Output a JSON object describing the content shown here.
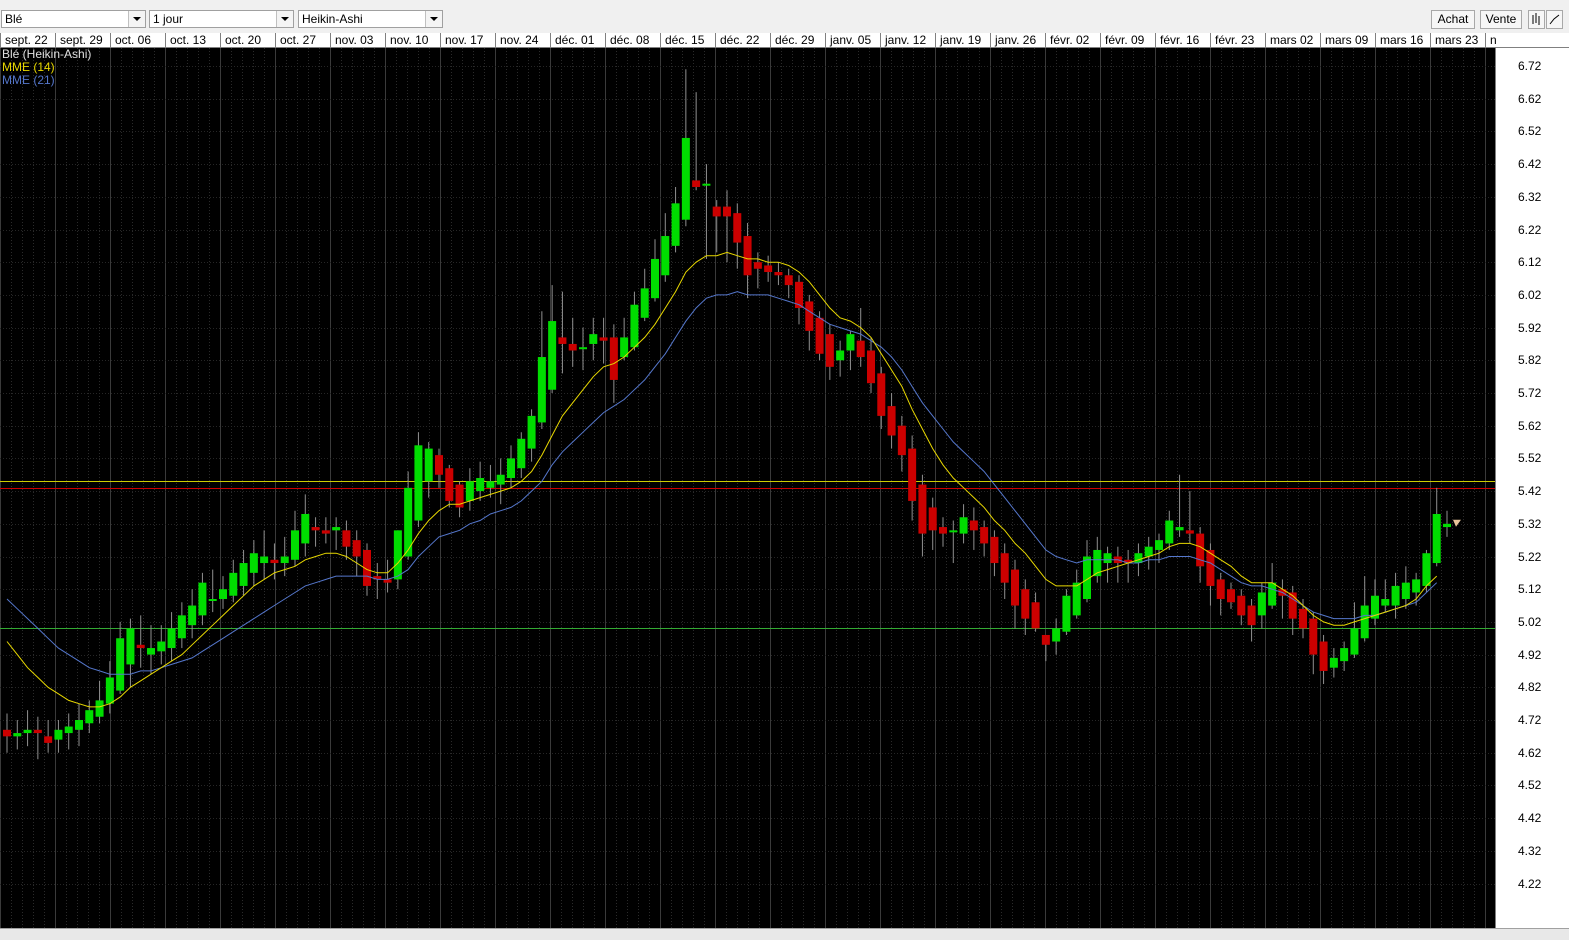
{
  "toolbar": {
    "instrument": "Blé",
    "period": "1 jour",
    "chart_style": "Heikin-Ashi",
    "buy_label": "Achat",
    "sell_label": "Vente",
    "bars_icon": "bar-chart-icon",
    "line_icon": "line-chart-icon"
  },
  "dates": [
    "sept. 22",
    "sept. 29",
    "oct. 06",
    "oct. 13",
    "oct. 20",
    "oct. 27",
    "nov. 03",
    "nov. 10",
    "nov. 17",
    "nov. 24",
    "déc. 01",
    "déc. 08",
    "déc. 15",
    "déc. 22",
    "déc. 29",
    "janv. 05",
    "janv. 12",
    "janv. 19",
    "janv. 26",
    "févr. 02",
    "févr. 09",
    "févr. 16",
    "févr. 23",
    "mars 02",
    "mars 09",
    "mars 16",
    "mars 23",
    "n"
  ],
  "price_labels": [
    "6.72",
    "6.62",
    "6.52",
    "6.42",
    "6.32",
    "6.22",
    "6.12",
    "6.02",
    "5.92",
    "5.82",
    "5.72",
    "5.62",
    "5.52",
    "5.42",
    "5.32",
    "5.22",
    "5.12",
    "5.02",
    "4.92",
    "4.82",
    "4.72",
    "4.62",
    "4.52",
    "4.42",
    "4.32",
    "4.22"
  ],
  "legend": {
    "title": "Blé (Heikin-Ashi)",
    "ema14": "MME (14)",
    "ema21": "MME (21)"
  },
  "colors": {
    "up": "#00dd00",
    "down": "#cc0000",
    "ema14": "#e8d800",
    "ema21": "#5577cc",
    "hline_yellow": "#cccc00",
    "hline_red": "#cc0000",
    "hline_green": "#33aa33",
    "last_marker": "#e8c49a"
  },
  "chart_data": {
    "type": "candlestick",
    "title": "Blé (Heikin-Ashi)",
    "xlabel": "",
    "ylabel": "",
    "ylim": [
      4.17,
      6.78
    ],
    "grid": true,
    "legend_position": "top-left",
    "horizontal_lines": [
      5.45,
      5.43,
      5.0
    ],
    "candles": [
      {
        "o": 4.69,
        "h": 4.74,
        "l": 4.62,
        "c": 4.67
      },
      {
        "o": 4.67,
        "h": 4.72,
        "l": 4.63,
        "c": 4.68
      },
      {
        "o": 4.68,
        "h": 4.75,
        "l": 4.64,
        "c": 4.69
      },
      {
        "o": 4.69,
        "h": 4.73,
        "l": 4.6,
        "c": 4.68
      },
      {
        "o": 4.67,
        "h": 4.72,
        "l": 4.62,
        "c": 4.65
      },
      {
        "o": 4.66,
        "h": 4.72,
        "l": 4.62,
        "c": 4.69
      },
      {
        "o": 4.68,
        "h": 4.74,
        "l": 4.63,
        "c": 4.7
      },
      {
        "o": 4.69,
        "h": 4.77,
        "l": 4.64,
        "c": 4.72
      },
      {
        "o": 4.71,
        "h": 4.78,
        "l": 4.68,
        "c": 4.75
      },
      {
        "o": 4.73,
        "h": 4.84,
        "l": 4.71,
        "c": 4.78
      },
      {
        "o": 4.77,
        "h": 4.9,
        "l": 4.74,
        "c": 4.85
      },
      {
        "o": 4.81,
        "h": 5.02,
        "l": 4.8,
        "c": 4.97
      },
      {
        "o": 4.89,
        "h": 5.03,
        "l": 4.82,
        "c": 5.0
      },
      {
        "o": 4.95,
        "h": 5.04,
        "l": 4.88,
        "c": 4.94
      },
      {
        "o": 4.92,
        "h": 5.01,
        "l": 4.86,
        "c": 4.94
      },
      {
        "o": 4.93,
        "h": 5.01,
        "l": 4.89,
        "c": 4.96
      },
      {
        "o": 4.94,
        "h": 5.05,
        "l": 4.9,
        "c": 5.0
      },
      {
        "o": 4.97,
        "h": 5.08,
        "l": 4.94,
        "c": 5.04
      },
      {
        "o": 5.01,
        "h": 5.12,
        "l": 4.97,
        "c": 5.07
      },
      {
        "o": 5.04,
        "h": 5.17,
        "l": 5.01,
        "c": 5.14
      },
      {
        "o": 5.09,
        "h": 5.18,
        "l": 5.05,
        "c": 5.09
      },
      {
        "o": 5.09,
        "h": 5.16,
        "l": 5.06,
        "c": 5.12
      },
      {
        "o": 5.1,
        "h": 5.21,
        "l": 5.08,
        "c": 5.17
      },
      {
        "o": 5.13,
        "h": 5.24,
        "l": 5.1,
        "c": 5.2
      },
      {
        "o": 5.17,
        "h": 5.27,
        "l": 5.13,
        "c": 5.23
      },
      {
        "o": 5.2,
        "h": 5.3,
        "l": 5.15,
        "c": 5.22
      },
      {
        "o": 5.21,
        "h": 5.26,
        "l": 5.15,
        "c": 5.2
      },
      {
        "o": 5.2,
        "h": 5.28,
        "l": 5.16,
        "c": 5.22
      },
      {
        "o": 5.21,
        "h": 5.36,
        "l": 5.19,
        "c": 5.3
      },
      {
        "o": 5.26,
        "h": 5.41,
        "l": 5.22,
        "c": 5.35
      },
      {
        "o": 5.31,
        "h": 5.34,
        "l": 5.25,
        "c": 5.3
      },
      {
        "o": 5.3,
        "h": 5.34,
        "l": 5.26,
        "c": 5.29
      },
      {
        "o": 5.3,
        "h": 5.34,
        "l": 5.24,
        "c": 5.31
      },
      {
        "o": 5.3,
        "h": 5.33,
        "l": 5.21,
        "c": 5.25
      },
      {
        "o": 5.27,
        "h": 5.3,
        "l": 5.16,
        "c": 5.22
      },
      {
        "o": 5.24,
        "h": 5.26,
        "l": 5.1,
        "c": 5.13
      },
      {
        "o": 5.16,
        "h": 5.2,
        "l": 5.09,
        "c": 5.15
      },
      {
        "o": 5.15,
        "h": 5.21,
        "l": 5.11,
        "c": 5.14
      },
      {
        "o": 5.15,
        "h": 5.3,
        "l": 5.12,
        "c": 5.3
      },
      {
        "o": 5.22,
        "h": 5.48,
        "l": 5.21,
        "c": 5.43
      },
      {
        "o": 5.33,
        "h": 5.6,
        "l": 5.31,
        "c": 5.56
      },
      {
        "o": 5.45,
        "h": 5.57,
        "l": 5.4,
        "c": 5.55
      },
      {
        "o": 5.53,
        "h": 5.55,
        "l": 5.43,
        "c": 5.47
      },
      {
        "o": 5.49,
        "h": 5.5,
        "l": 5.37,
        "c": 5.39
      },
      {
        "o": 5.44,
        "h": 5.45,
        "l": 5.34,
        "c": 5.37
      },
      {
        "o": 5.39,
        "h": 5.49,
        "l": 5.36,
        "c": 5.45
      },
      {
        "o": 5.42,
        "h": 5.51,
        "l": 5.39,
        "c": 5.46
      },
      {
        "o": 5.43,
        "h": 5.5,
        "l": 5.4,
        "c": 5.45
      },
      {
        "o": 5.44,
        "h": 5.52,
        "l": 5.38,
        "c": 5.47
      },
      {
        "o": 5.46,
        "h": 5.56,
        "l": 5.43,
        "c": 5.52
      },
      {
        "o": 5.49,
        "h": 5.6,
        "l": 5.46,
        "c": 5.58
      },
      {
        "o": 5.55,
        "h": 5.67,
        "l": 5.51,
        "c": 5.65
      },
      {
        "o": 5.63,
        "h": 5.97,
        "l": 5.61,
        "c": 5.83
      },
      {
        "o": 5.73,
        "h": 6.05,
        "l": 5.72,
        "c": 5.94
      },
      {
        "o": 5.89,
        "h": 6.03,
        "l": 5.78,
        "c": 5.87
      },
      {
        "o": 5.87,
        "h": 5.95,
        "l": 5.8,
        "c": 5.85
      },
      {
        "o": 5.86,
        "h": 5.92,
        "l": 5.79,
        "c": 5.86
      },
      {
        "o": 5.87,
        "h": 5.95,
        "l": 5.82,
        "c": 5.9
      },
      {
        "o": 5.89,
        "h": 5.95,
        "l": 5.81,
        "c": 5.88
      },
      {
        "o": 5.89,
        "h": 5.93,
        "l": 5.69,
        "c": 5.76
      },
      {
        "o": 5.83,
        "h": 5.95,
        "l": 5.82,
        "c": 5.89
      },
      {
        "o": 5.86,
        "h": 6.03,
        "l": 5.85,
        "c": 5.99
      },
      {
        "o": 5.95,
        "h": 6.1,
        "l": 5.94,
        "c": 6.04
      },
      {
        "o": 6.01,
        "h": 6.19,
        "l": 6.0,
        "c": 6.13
      },
      {
        "o": 6.08,
        "h": 6.27,
        "l": 6.06,
        "c": 6.2
      },
      {
        "o": 6.17,
        "h": 6.35,
        "l": 6.15,
        "c": 6.3
      },
      {
        "o": 6.25,
        "h": 6.71,
        "l": 6.23,
        "c": 6.5
      },
      {
        "o": 6.37,
        "h": 6.64,
        "l": 6.34,
        "c": 6.35
      },
      {
        "o": 6.36,
        "h": 6.42,
        "l": 6.13,
        "c": 6.36
      },
      {
        "o": 6.29,
        "h": 6.31,
        "l": 6.15,
        "c": 6.26
      },
      {
        "o": 6.29,
        "h": 6.34,
        "l": 6.12,
        "c": 6.26
      },
      {
        "o": 6.27,
        "h": 6.3,
        "l": 6.1,
        "c": 6.18
      },
      {
        "o": 6.2,
        "h": 6.24,
        "l": 6.01,
        "c": 6.08
      },
      {
        "o": 6.12,
        "h": 6.15,
        "l": 6.04,
        "c": 6.1
      },
      {
        "o": 6.11,
        "h": 6.14,
        "l": 6.06,
        "c": 6.09
      },
      {
        "o": 6.09,
        "h": 6.12,
        "l": 6.05,
        "c": 6.08
      },
      {
        "o": 6.08,
        "h": 6.1,
        "l": 6.01,
        "c": 6.05
      },
      {
        "o": 6.06,
        "h": 6.08,
        "l": 5.93,
        "c": 5.98
      },
      {
        "o": 6.0,
        "h": 6.02,
        "l": 5.85,
        "c": 5.91
      },
      {
        "o": 5.95,
        "h": 5.97,
        "l": 5.82,
        "c": 5.84
      },
      {
        "o": 5.9,
        "h": 5.93,
        "l": 5.76,
        "c": 5.8
      },
      {
        "o": 5.82,
        "h": 5.88,
        "l": 5.77,
        "c": 5.85
      },
      {
        "o": 5.85,
        "h": 5.91,
        "l": 5.79,
        "c": 5.9
      },
      {
        "o": 5.88,
        "h": 5.98,
        "l": 5.8,
        "c": 5.83
      },
      {
        "o": 5.85,
        "h": 5.89,
        "l": 5.72,
        "c": 5.75
      },
      {
        "o": 5.78,
        "h": 5.8,
        "l": 5.61,
        "c": 5.65
      },
      {
        "o": 5.68,
        "h": 5.72,
        "l": 5.55,
        "c": 5.59
      },
      {
        "o": 5.62,
        "h": 5.65,
        "l": 5.48,
        "c": 5.53
      },
      {
        "o": 5.55,
        "h": 5.59,
        "l": 5.33,
        "c": 5.39
      },
      {
        "o": 5.44,
        "h": 5.47,
        "l": 5.22,
        "c": 5.29
      },
      {
        "o": 5.37,
        "h": 5.4,
        "l": 5.24,
        "c": 5.3
      },
      {
        "o": 5.31,
        "h": 5.34,
        "l": 5.25,
        "c": 5.29
      },
      {
        "o": 5.3,
        "h": 5.33,
        "l": 5.2,
        "c": 5.3
      },
      {
        "o": 5.29,
        "h": 5.38,
        "l": 5.26,
        "c": 5.34
      },
      {
        "o": 5.33,
        "h": 5.37,
        "l": 5.24,
        "c": 5.3
      },
      {
        "o": 5.31,
        "h": 5.33,
        "l": 5.22,
        "c": 5.26
      },
      {
        "o": 5.28,
        "h": 5.3,
        "l": 5.16,
        "c": 5.2
      },
      {
        "o": 5.23,
        "h": 5.26,
        "l": 5.09,
        "c": 5.14
      },
      {
        "o": 5.18,
        "h": 5.21,
        "l": 5.0,
        "c": 5.07
      },
      {
        "o": 5.12,
        "h": 5.15,
        "l": 4.98,
        "c": 5.03
      },
      {
        "o": 5.08,
        "h": 5.11,
        "l": 4.99,
        "c": 5.0
      },
      {
        "o": 4.98,
        "h": 4.97,
        "l": 4.9,
        "c": 4.95
      },
      {
        "o": 4.96,
        "h": 5.03,
        "l": 4.92,
        "c": 5.0
      },
      {
        "o": 4.99,
        "h": 5.12,
        "l": 4.98,
        "c": 5.1
      },
      {
        "o": 5.04,
        "h": 5.18,
        "l": 5.03,
        "c": 5.14
      },
      {
        "o": 5.09,
        "h": 5.27,
        "l": 5.08,
        "c": 5.22
      },
      {
        "o": 5.16,
        "h": 5.28,
        "l": 5.14,
        "c": 5.24
      },
      {
        "o": 5.2,
        "h": 5.25,
        "l": 5.14,
        "c": 5.23
      },
      {
        "o": 5.22,
        "h": 5.25,
        "l": 5.14,
        "c": 5.2
      },
      {
        "o": 5.21,
        "h": 5.24,
        "l": 5.14,
        "c": 5.2
      },
      {
        "o": 5.2,
        "h": 5.26,
        "l": 5.16,
        "c": 5.23
      },
      {
        "o": 5.22,
        "h": 5.28,
        "l": 5.18,
        "c": 5.25
      },
      {
        "o": 5.24,
        "h": 5.29,
        "l": 5.2,
        "c": 5.27
      },
      {
        "o": 5.26,
        "h": 5.36,
        "l": 5.24,
        "c": 5.33
      },
      {
        "o": 5.3,
        "h": 5.47,
        "l": 5.28,
        "c": 5.31
      },
      {
        "o": 5.3,
        "h": 5.42,
        "l": 5.26,
        "c": 5.29
      },
      {
        "o": 5.29,
        "h": 5.31,
        "l": 5.14,
        "c": 5.19
      },
      {
        "o": 5.24,
        "h": 5.26,
        "l": 5.07,
        "c": 5.13
      },
      {
        "o": 5.15,
        "h": 5.17,
        "l": 5.04,
        "c": 5.09
      },
      {
        "o": 5.12,
        "h": 5.14,
        "l": 5.06,
        "c": 5.08
      },
      {
        "o": 5.1,
        "h": 5.12,
        "l": 5.01,
        "c": 5.04
      },
      {
        "o": 5.07,
        "h": 5.09,
        "l": 4.96,
        "c": 5.01
      },
      {
        "o": 5.04,
        "h": 5.14,
        "l": 5.0,
        "c": 5.11
      },
      {
        "o": 5.07,
        "h": 5.2,
        "l": 5.06,
        "c": 5.14
      },
      {
        "o": 5.12,
        "h": 5.15,
        "l": 5.03,
        "c": 5.1
      },
      {
        "o": 5.11,
        "h": 5.13,
        "l": 4.98,
        "c": 5.03
      },
      {
        "o": 5.06,
        "h": 5.09,
        "l": 4.97,
        "c": 5.0
      },
      {
        "o": 5.03,
        "h": 5.05,
        "l": 4.86,
        "c": 4.92
      },
      {
        "o": 4.96,
        "h": 4.98,
        "l": 4.83,
        "c": 4.87
      },
      {
        "o": 4.88,
        "h": 4.94,
        "l": 4.85,
        "c": 4.91
      },
      {
        "o": 4.9,
        "h": 4.96,
        "l": 4.87,
        "c": 4.94
      },
      {
        "o": 4.92,
        "h": 5.08,
        "l": 4.91,
        "c": 5.0
      },
      {
        "o": 4.97,
        "h": 5.16,
        "l": 4.96,
        "c": 5.07
      },
      {
        "o": 5.03,
        "h": 5.15,
        "l": 5.01,
        "c": 5.1
      },
      {
        "o": 5.07,
        "h": 5.15,
        "l": 5.05,
        "c": 5.09
      },
      {
        "o": 5.07,
        "h": 5.17,
        "l": 5.03,
        "c": 5.13
      },
      {
        "o": 5.09,
        "h": 5.19,
        "l": 5.06,
        "c": 5.14
      },
      {
        "o": 5.11,
        "h": 5.17,
        "l": 5.07,
        "c": 5.15
      },
      {
        "o": 5.13,
        "h": 5.24,
        "l": 5.11,
        "c": 5.23
      },
      {
        "o": 5.2,
        "h": 5.43,
        "l": 5.19,
        "c": 5.35
      },
      {
        "o": 5.31,
        "h": 5.36,
        "l": 5.28,
        "c": 5.32
      }
    ],
    "ema14": [
      4.96,
      4.92,
      4.88,
      4.85,
      4.82,
      4.8,
      4.78,
      4.77,
      4.76,
      4.76,
      4.77,
      4.79,
      4.82,
      4.84,
      4.86,
      4.88,
      4.9,
      4.92,
      4.95,
      4.98,
      5.01,
      5.04,
      5.07,
      5.1,
      5.13,
      5.15,
      5.17,
      5.18,
      5.19,
      5.21,
      5.22,
      5.23,
      5.23,
      5.22,
      5.2,
      5.18,
      5.17,
      5.17,
      5.2,
      5.24,
      5.29,
      5.33,
      5.36,
      5.38,
      5.38,
      5.39,
      5.4,
      5.41,
      5.42,
      5.43,
      5.45,
      5.48,
      5.53,
      5.59,
      5.65,
      5.69,
      5.73,
      5.77,
      5.8,
      5.81,
      5.83,
      5.86,
      5.89,
      5.93,
      5.98,
      6.03,
      6.09,
      6.12,
      6.14,
      6.14,
      6.15,
      6.14,
      6.13,
      6.13,
      6.12,
      6.12,
      6.11,
      6.09,
      6.06,
      6.02,
      5.98,
      5.95,
      5.94,
      5.92,
      5.89,
      5.84,
      5.79,
      5.74,
      5.67,
      5.61,
      5.55,
      5.5,
      5.46,
      5.43,
      5.4,
      5.37,
      5.33,
      5.3,
      5.26,
      5.23,
      5.19,
      5.15,
      5.13,
      5.13,
      5.13,
      5.15,
      5.17,
      5.18,
      5.19,
      5.2,
      5.21,
      5.22,
      5.23,
      5.25,
      5.26,
      5.26,
      5.25,
      5.23,
      5.21,
      5.19,
      5.16,
      5.14,
      5.14,
      5.14,
      5.12,
      5.1,
      5.07,
      5.04,
      5.02,
      5.01,
      5.01,
      5.02,
      5.03,
      5.04,
      5.05,
      5.06,
      5.07,
      5.09,
      5.13,
      5.16
    ],
    "ema21": [
      5.09,
      5.06,
      5.03,
      5.0,
      4.97,
      4.94,
      4.92,
      4.9,
      4.88,
      4.87,
      4.86,
      4.86,
      4.86,
      4.87,
      4.87,
      4.88,
      4.89,
      4.9,
      4.91,
      4.93,
      4.95,
      4.97,
      4.99,
      5.01,
      5.03,
      5.05,
      5.07,
      5.09,
      5.11,
      5.13,
      5.14,
      5.15,
      5.16,
      5.16,
      5.16,
      5.16,
      5.15,
      5.15,
      5.16,
      5.18,
      5.22,
      5.25,
      5.28,
      5.29,
      5.3,
      5.32,
      5.33,
      5.35,
      5.36,
      5.37,
      5.39,
      5.42,
      5.45,
      5.5,
      5.54,
      5.57,
      5.6,
      5.63,
      5.66,
      5.68,
      5.7,
      5.73,
      5.76,
      5.8,
      5.84,
      5.89,
      5.94,
      5.98,
      6.01,
      6.02,
      6.02,
      6.03,
      6.02,
      6.02,
      6.02,
      6.01,
      6.0,
      5.99,
      5.97,
      5.95,
      5.93,
      5.92,
      5.91,
      5.9,
      5.88,
      5.86,
      5.83,
      5.79,
      5.74,
      5.69,
      5.65,
      5.61,
      5.57,
      5.54,
      5.51,
      5.48,
      5.44,
      5.4,
      5.36,
      5.32,
      5.28,
      5.24,
      5.22,
      5.21,
      5.2,
      5.21,
      5.21,
      5.21,
      5.21,
      5.2,
      5.2,
      5.21,
      5.21,
      5.22,
      5.22,
      5.22,
      5.21,
      5.2,
      5.18,
      5.16,
      5.14,
      5.13,
      5.13,
      5.12,
      5.11,
      5.09,
      5.07,
      5.05,
      5.04,
      5.03,
      5.03,
      5.03,
      5.04,
      5.04,
      5.05,
      5.06,
      5.07,
      5.08,
      5.11,
      5.14
    ]
  }
}
